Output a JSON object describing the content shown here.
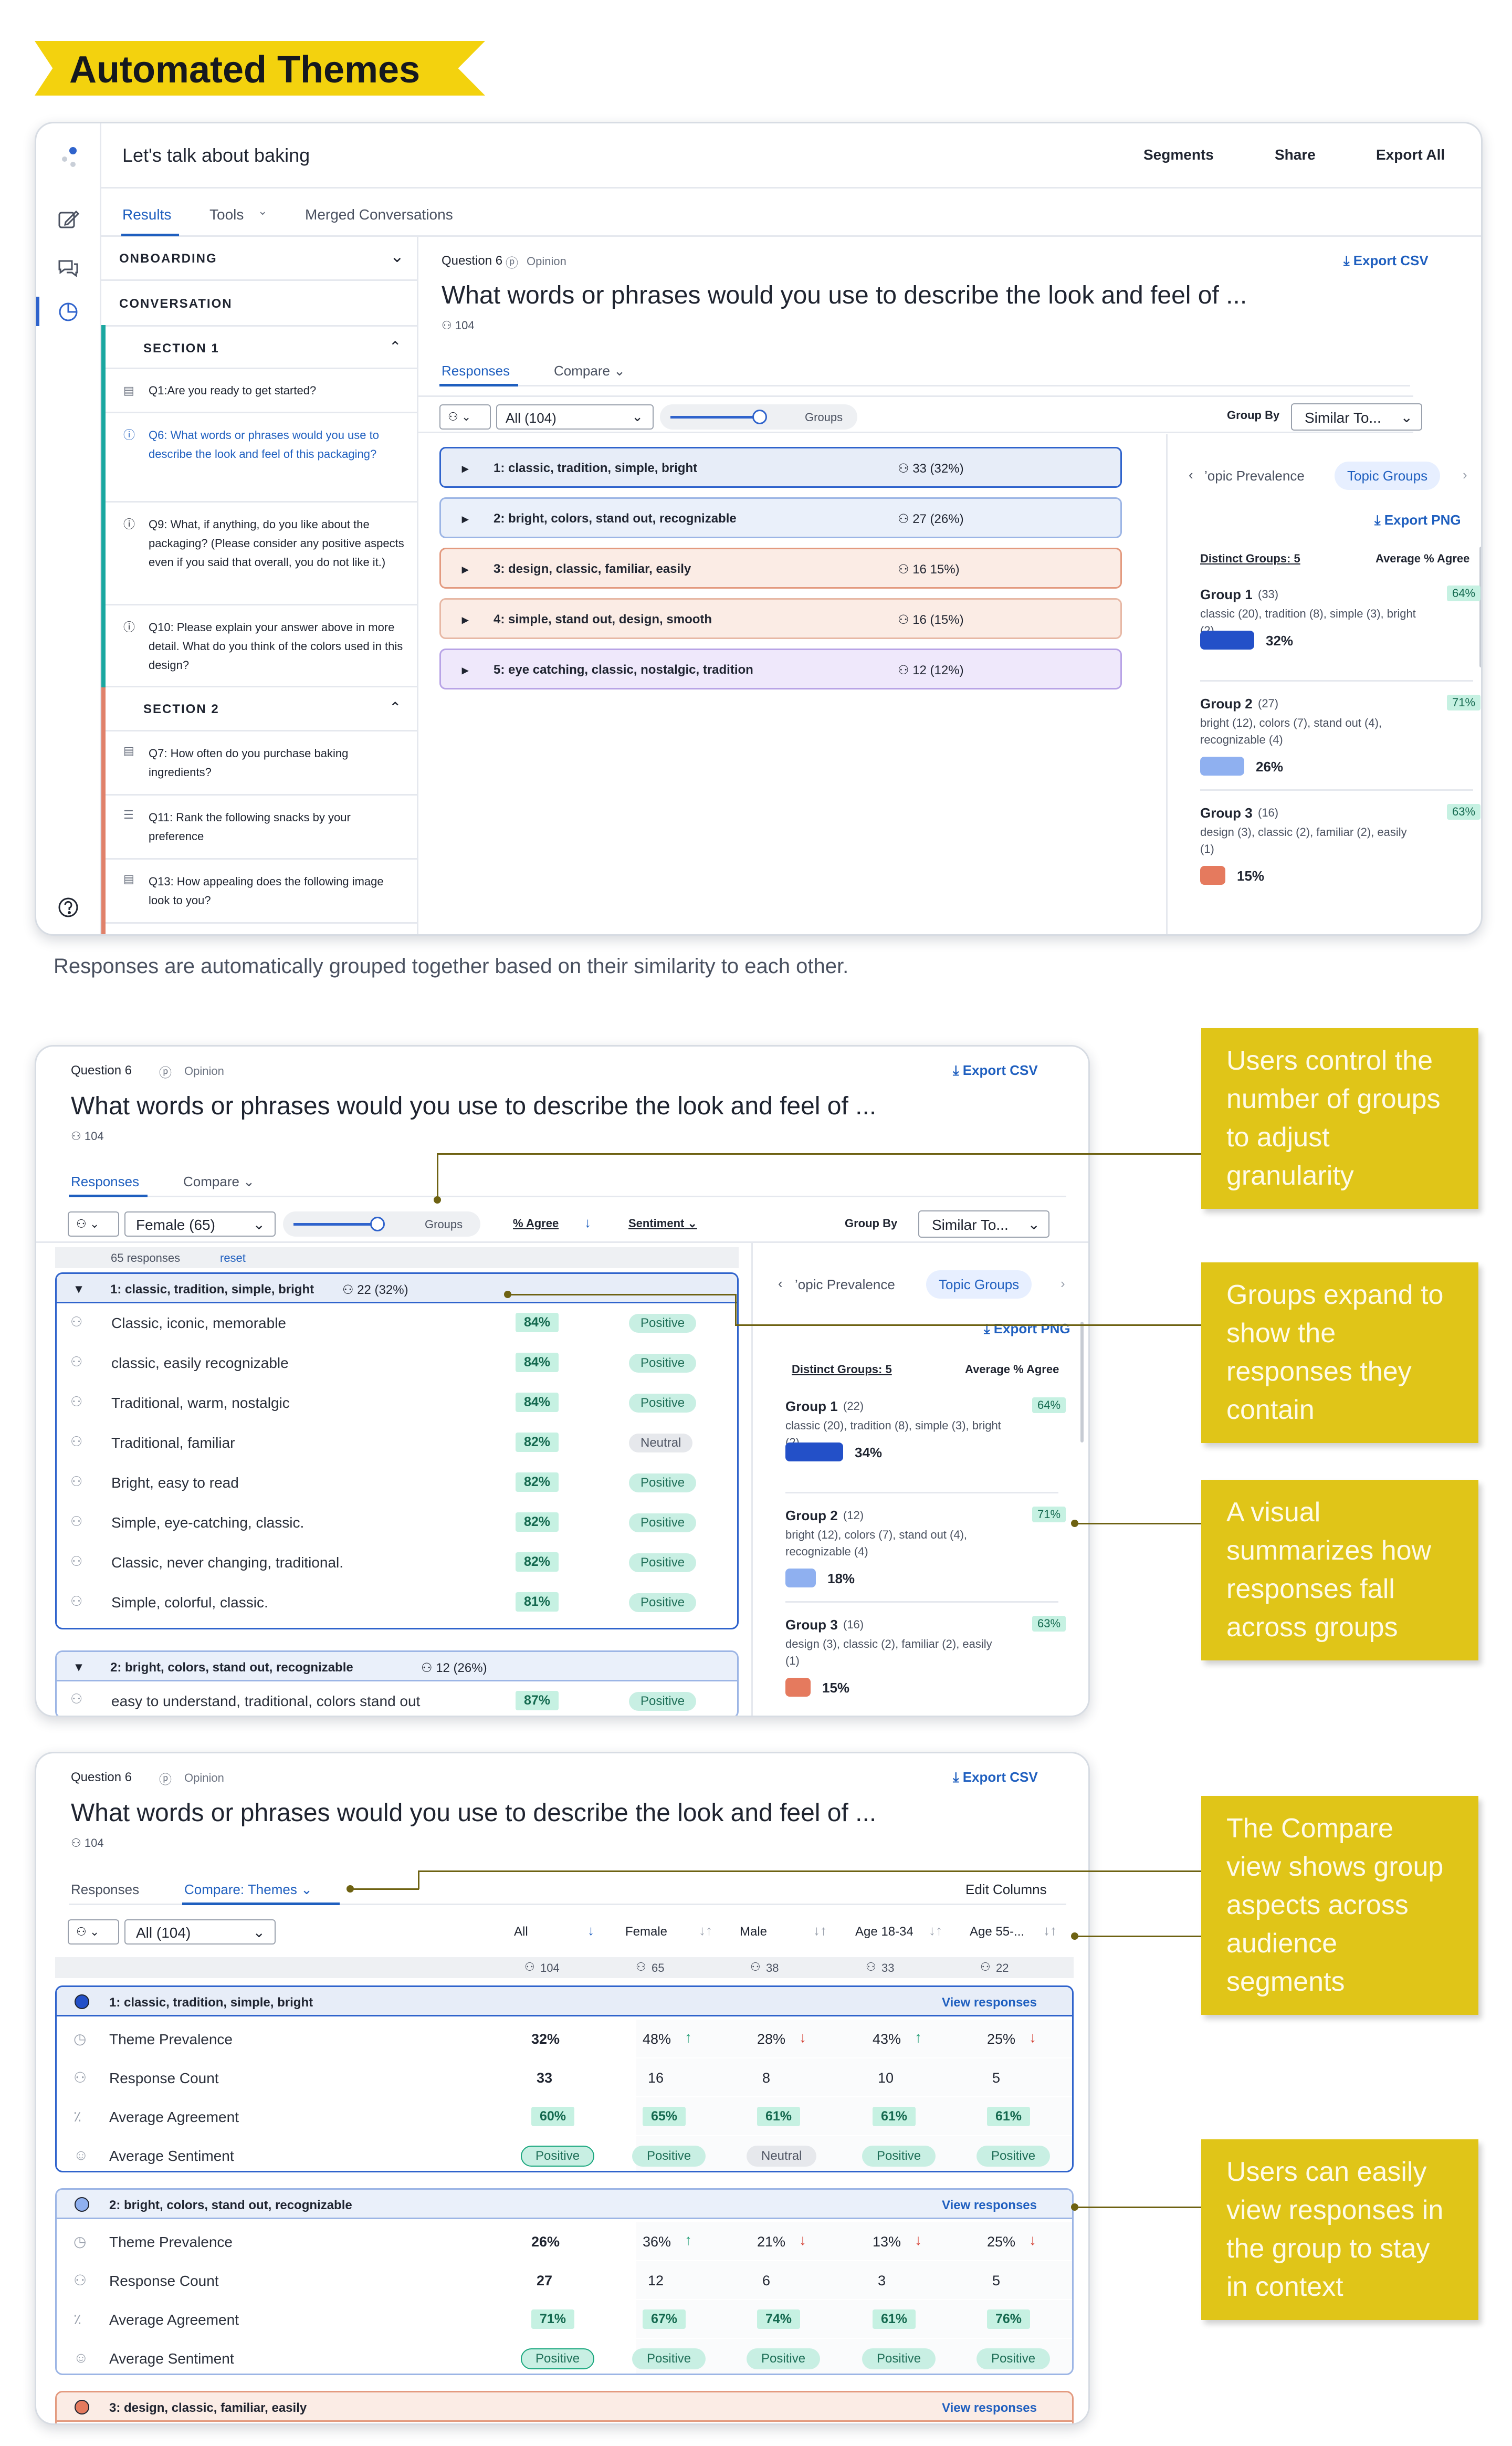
{
  "header_tag": "Automated Themes",
  "caption": "Responses are automatically grouped together based on their similarity to each other.",
  "app": {
    "title": "Let's talk about baking",
    "top_actions": [
      "Segments",
      "Share",
      "Export All"
    ],
    "tabs": [
      "Results",
      "Tools",
      "Merged Conversations"
    ],
    "sidebar": {
      "onboarding": "ONBOARDING",
      "conversation": "CONVERSATION",
      "section1": "SECTION 1",
      "section2": "SECTION 2",
      "q1": "Q1:Are you ready to get started?",
      "q6": "Q6: What words or phrases would you use to describe the look and feel of this packaging?",
      "q9": "Q9: What, if anything, do you like about the packaging? (Please consider any positive aspects even if you said that overall, you do not like it.)",
      "q10": "Q10: Please explain your answer above in more detail. What do you think of the colors used in this design?",
      "q7": "Q7: How often do you purchase baking ingredients?",
      "q11": "Q11: Rank the following snacks by your preference",
      "q13": "Q13: How appealing does the following image look to you?"
    }
  },
  "question": {
    "number": "Question 6",
    "type": "Opinion",
    "text": "What words or phrases would you use to describe the look and feel of ...",
    "count": "104",
    "export_csv": "Export CSV",
    "tab_responses": "Responses",
    "tab_compare": "Compare",
    "tab_compare_themes": "Compare: Themes",
    "edit_columns": "Edit Columns",
    "filter_all": "All (104)",
    "filter_female": "Female (65)",
    "groups_label": "Groups",
    "group_by": "Group By",
    "group_by_value": "Similar To...",
    "agree_col": "% Agree",
    "sentiment_col": "Sentiment",
    "responses_count": "65 responses",
    "reset": "reset"
  },
  "groups": [
    {
      "label": "1: classic, tradition, simple, bright",
      "count": "33 (32%)",
      "female_count": "22 (32%)"
    },
    {
      "label": "2: bright, colors, stand out, recognizable",
      "count": "27 (26%)",
      "female_count": "12 (26%)"
    },
    {
      "label": "3: design, classic, familiar, easily",
      "count": "16 15%)"
    },
    {
      "label": "4: simple, stand out, design, smooth",
      "count": "16 (15%)"
    },
    {
      "label": "5: eye catching, classic, nostalgic, tradition",
      "count": "12 (12%)"
    }
  ],
  "chart_panel": {
    "tab_prevalence": "Topic Prevalence",
    "tab_prevalence_clipped": "’opic Prevalence",
    "tab_groups": "Topic Groups",
    "export_png": "Export PNG",
    "distinct": "Distinct Groups: 5",
    "avg_agree": "Average % Agree",
    "items": [
      {
        "name": "Group 1",
        "n": "(33)",
        "n_female": "(22)",
        "agree": "64%",
        "words": "classic (20), tradition (8), simple (3), bright (2)",
        "pct": "32%",
        "pct_female": "34%",
        "color": "#2350c8"
      },
      {
        "name": "Group 2",
        "n": "(27)",
        "n_female": "(12)",
        "agree": "71%",
        "words": "bright (12), colors (7), stand out (4), recognizable (4)",
        "pct": "26%",
        "pct_female": "18%",
        "color": "#8fb0f0"
      },
      {
        "name": "Group 3",
        "n": "(16)",
        "n_female": "(16)",
        "agree": "63%",
        "words": "design (3), classic (2), familiar (2), easily (1)",
        "pct": "15%",
        "pct_female": "15%",
        "color": "#e57a5e"
      }
    ]
  },
  "chart_data": {
    "type": "bar",
    "title": "",
    "categories": [
      "Group 1",
      "Group 2",
      "Group 3"
    ],
    "series": [
      {
        "name": "All",
        "values": [
          32,
          26,
          15
        ]
      },
      {
        "name": "Female",
        "values": [
          34,
          18,
          15
        ]
      }
    ],
    "ylabel": "",
    "xlabel": ""
  },
  "responses": [
    {
      "text": "Classic, iconic, memorable",
      "agree": "84%",
      "sentiment": "Positive"
    },
    {
      "text": "classic, easily recognizable",
      "agree": "84%",
      "sentiment": "Positive"
    },
    {
      "text": "Traditional, warm, nostalgic",
      "agree": "84%",
      "sentiment": "Positive"
    },
    {
      "text": "Traditional, familiar",
      "agree": "82%",
      "sentiment": "Neutral"
    },
    {
      "text": "Bright, easy to read",
      "agree": "82%",
      "sentiment": "Positive"
    },
    {
      "text": "Simple, eye-catching, classic.",
      "agree": "82%",
      "sentiment": "Positive"
    },
    {
      "text": "Classic, never changing, traditional.",
      "agree": "82%",
      "sentiment": "Positive"
    },
    {
      "text": "Simple, colorful, classic.",
      "agree": "81%",
      "sentiment": "Positive"
    },
    {
      "text": "easy to understand, traditional, colors stand out",
      "agree": "87%",
      "sentiment": "Positive"
    }
  ],
  "compare": {
    "columns": [
      {
        "name": "All",
        "n": "104"
      },
      {
        "name": "Female",
        "n": "65"
      },
      {
        "name": "Male",
        "n": "38"
      },
      {
        "name": "Age 18-34",
        "n": "33"
      },
      {
        "name": "Age 55-...",
        "n": "22"
      }
    ],
    "view_responses": "View responses",
    "metrics": [
      "Theme Prevalence",
      "Response Count",
      "Average Agreement",
      "Average Sentiment"
    ],
    "themes": [
      {
        "label": "1: classic, tradition, simple, bright",
        "prevalence": [
          "32%",
          "48%",
          "28%",
          "43%",
          "25%"
        ],
        "trend": [
          "",
          "up",
          "dn",
          "up",
          "dn"
        ],
        "count": [
          "33",
          "16",
          "8",
          "10",
          "5"
        ],
        "agreement": [
          "60%",
          "65%",
          "61%",
          "61%",
          "61%"
        ],
        "sentiment": [
          "Positive",
          "Positive",
          "Neutral",
          "Positive",
          "Positive"
        ]
      },
      {
        "label": "2: bright, colors, stand out, recognizable",
        "prevalence": [
          "26%",
          "36%",
          "21%",
          "13%",
          "25%"
        ],
        "trend": [
          "",
          "up",
          "dn",
          "dn",
          "dn"
        ],
        "count": [
          "27",
          "12",
          "6",
          "3",
          "5"
        ],
        "agreement": [
          "71%",
          "67%",
          "74%",
          "61%",
          "76%"
        ],
        "sentiment": [
          "Positive",
          "Positive",
          "Positive",
          "Positive",
          "Positive"
        ]
      },
      {
        "label": "3: design, classic, familiar, easily"
      }
    ]
  },
  "notes": {
    "n1": "Users control the number of groups to adjust granularity",
    "n2": "Groups expand to show the responses they contain",
    "n3": "A visual summarizes how responses fall across groups",
    "n4": "The Compare view shows group aspects across audience segments",
    "n5": "Users can easily view responses in the group to stay in context"
  }
}
